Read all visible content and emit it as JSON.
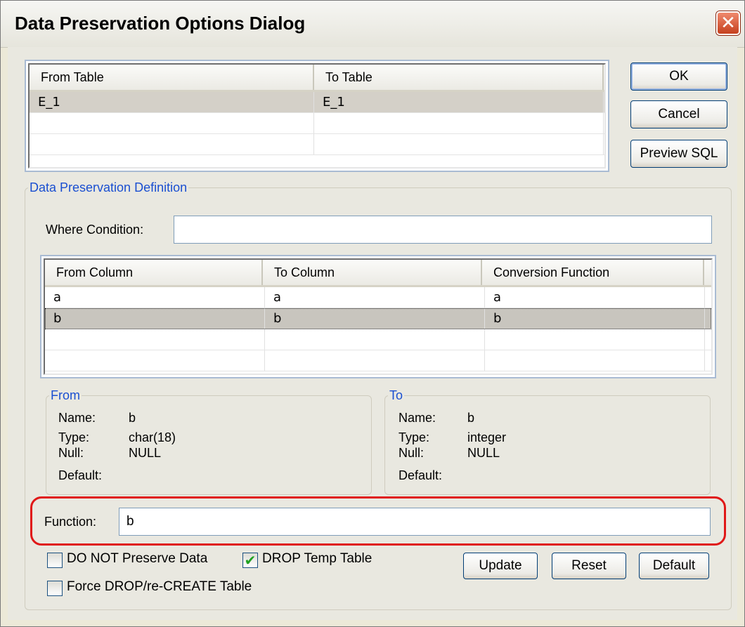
{
  "window": {
    "title": "Data Preservation Options Dialog",
    "close_glyph": "✕"
  },
  "tables_grid": {
    "columns": [
      "From Table",
      "To Table"
    ],
    "rows": [
      [
        "E_1",
        "E_1"
      ],
      [
        "",
        ""
      ],
      [
        "",
        ""
      ]
    ]
  },
  "buttons": {
    "ok": "OK",
    "cancel": "Cancel",
    "preview_sql": "Preview SQL",
    "update": "Update",
    "reset": "Reset",
    "default": "Default"
  },
  "definition": {
    "group_title": "Data Preservation Definition",
    "where_label": "Where Condition:",
    "where_value": "",
    "columns_grid": {
      "columns": [
        "From Column",
        "To Column",
        "Conversion Function"
      ],
      "rows": [
        [
          "a",
          "a",
          "a"
        ],
        [
          "b",
          "b",
          "b"
        ],
        [
          "",
          "",
          ""
        ],
        [
          "",
          "",
          ""
        ]
      ]
    },
    "from": {
      "title": "From",
      "name_label": "Name:",
      "name": "b",
      "type_label": "Type:",
      "type": "char(18)",
      "null_label": "Null:",
      "null": "NULL",
      "default_label": "Default:",
      "default": ""
    },
    "to": {
      "title": "To",
      "name_label": "Name:",
      "name": "b",
      "type_label": "Type:",
      "type": "integer",
      "null_label": "Null:",
      "null": "NULL",
      "default_label": "Default:",
      "default": ""
    },
    "function_label": "Function:",
    "function_value": "b",
    "checkboxes": {
      "do_not_preserve": {
        "label": "DO NOT Preserve Data",
        "checked": false
      },
      "drop_temp": {
        "label": "DROP Temp Table",
        "checked": true
      },
      "force_drop": {
        "label": "Force DROP/re-CREATE Table",
        "checked": false
      }
    },
    "check_glyph": "✔"
  },
  "colors": {
    "highlight": "#e01818",
    "group_title": "#1a4fd1",
    "selected_row": "#c8c5be"
  }
}
